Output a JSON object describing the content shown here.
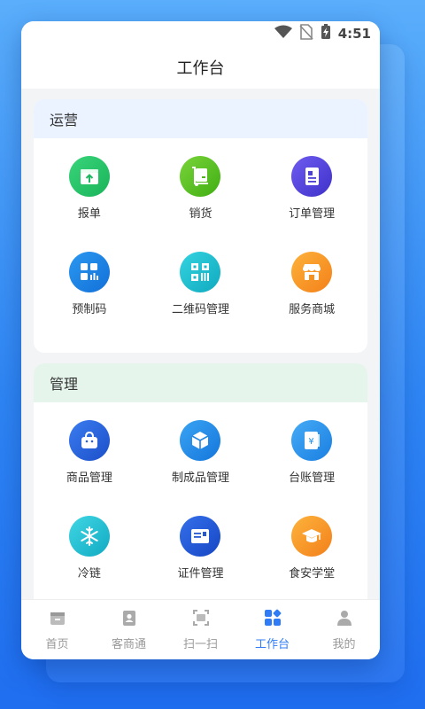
{
  "status_bar": {
    "time": "4:51"
  },
  "page": {
    "title": "工作台"
  },
  "sections": [
    {
      "title": "运营",
      "items": [
        {
          "label": "报单",
          "icon": "upload-box-icon",
          "color": "#27c26a"
        },
        {
          "label": "销货",
          "icon": "cart-icon",
          "color": "#5ac41e"
        },
        {
          "label": "订单管理",
          "icon": "document-icon",
          "color": "#5a4be6"
        },
        {
          "label": "预制码",
          "icon": "grid-barcode-icon",
          "color": "#1f84e8"
        },
        {
          "label": "二维码管理",
          "icon": "qr-code-icon",
          "color": "#1cbfd0"
        },
        {
          "label": "服务商城",
          "icon": "store-icon",
          "color": "#f7941d"
        }
      ]
    },
    {
      "title": "管理",
      "items": [
        {
          "label": "商品管理",
          "icon": "bag-icon",
          "color": "#2b62e0"
        },
        {
          "label": "制成品管理",
          "icon": "box-icon",
          "color": "#2a8de8"
        },
        {
          "label": "台账管理",
          "icon": "ledger-icon",
          "color": "#2a96ee"
        },
        {
          "label": "冷链",
          "icon": "snowflake-icon",
          "color": "#1bbfd2"
        },
        {
          "label": "证件管理",
          "icon": "id-card-icon",
          "color": "#2460dc"
        },
        {
          "label": "食安学堂",
          "icon": "graduation-cap-icon",
          "color": "#f7921c"
        }
      ]
    }
  ],
  "tabs": [
    {
      "label": "首页",
      "icon": "home-icon",
      "active": false
    },
    {
      "label": "客商通",
      "icon": "contacts-icon",
      "active": false
    },
    {
      "label": "扫一扫",
      "icon": "scan-icon",
      "active": false
    },
    {
      "label": "工作台",
      "icon": "workbench-icon",
      "active": true
    },
    {
      "label": "我的",
      "icon": "user-icon",
      "active": false
    }
  ],
  "colors": {
    "accent": "#2f7cf6",
    "background_gradient": [
      "#5aaefb",
      "#1f6ef0"
    ]
  }
}
